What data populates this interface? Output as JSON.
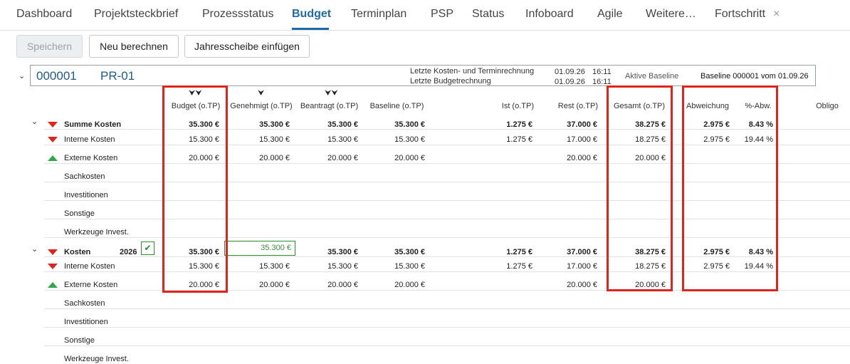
{
  "tabs": [
    {
      "label": "Dashboard",
      "active": false
    },
    {
      "label": "Projektsteckbrief",
      "active": false
    },
    {
      "label": "Prozessstatus",
      "active": false
    },
    {
      "label": "Budget",
      "active": true
    },
    {
      "label": "Terminplan",
      "active": false
    },
    {
      "label": "PSP",
      "active": false
    },
    {
      "label": "Status",
      "active": false
    },
    {
      "label": "Infoboard",
      "active": false
    },
    {
      "label": "Agile",
      "active": false
    },
    {
      "label": "Weitere…",
      "active": false
    },
    {
      "label": "Fortschritt",
      "active": false
    }
  ],
  "tab_close_glyph": "×",
  "toolbar": {
    "save_label": "Speichern",
    "recalc_label": "Neu berechnen",
    "insert_year_label": "Jahresscheibe einfügen"
  },
  "project": {
    "id": "000001",
    "name": "PR-01",
    "last_cost_label": "Letzte Kosten- und Terminrechnung",
    "last_budget_label": "Letzte Budgetrechnung",
    "last_cost_date": "01.09.26",
    "last_cost_time": "16:11",
    "last_budget_date": "01.09.26",
    "last_budget_time": "16:11",
    "active_baseline_label": "Aktive Baseline",
    "baseline_value": "Baseline 000001 vom 01.09.26"
  },
  "columns": {
    "budget": "Budget (o.TP)",
    "genehmigt": "Genehmigt (o.TP)",
    "beantragt": "Beantragt (o.TP)",
    "baseline": "Baseline (o.TP)",
    "ist": "Ist (o.TP)",
    "rest": "Rest (o.TP)",
    "gesamt": "Gesamt (o.TP)",
    "abweichung": "Abweichung",
    "pct_abw": "%-Abw.",
    "obligo": "Obligo"
  },
  "column_icons": {
    "budget": "⮟⮟",
    "genehmigt": "⮟",
    "beantragt": "⮟⮟"
  },
  "rows": [
    {
      "label": "Summe Kosten",
      "bold": true,
      "year": "",
      "budget": "35.300 €",
      "genehmigt": "35.300 €",
      "beantragt": "35.300 €",
      "baseline": "35.300 €",
      "ist": "1.275 €",
      "rest": "37.000 €",
      "gesamt": "38.275 €",
      "abw": "2.975 €",
      "pct": "8.43 %"
    },
    {
      "label": "Interne Kosten",
      "bold": false,
      "year": "",
      "budget": "15.300 €",
      "genehmigt": "15.300 €",
      "beantragt": "15.300 €",
      "baseline": "15.300 €",
      "ist": "1.275 €",
      "rest": "17.000 €",
      "gesamt": "18.275 €",
      "abw": "2.975 €",
      "pct": "19.44 %"
    },
    {
      "label": "Externe Kosten",
      "bold": false,
      "year": "",
      "budget": "20.000 €",
      "genehmigt": "20.000 €",
      "beantragt": "20.000 €",
      "baseline": "20.000 €",
      "ist": "",
      "rest": "20.000 €",
      "gesamt": "20.000 €",
      "abw": "",
      "pct": ""
    },
    {
      "label": "Sachkosten",
      "bold": false,
      "year": "",
      "budget": "",
      "genehmigt": "",
      "beantragt": "",
      "baseline": "",
      "ist": "",
      "rest": "",
      "gesamt": "",
      "abw": "",
      "pct": ""
    },
    {
      "label": "Investitionen",
      "bold": false,
      "year": "",
      "budget": "",
      "genehmigt": "",
      "beantragt": "",
      "baseline": "",
      "ist": "",
      "rest": "",
      "gesamt": "",
      "abw": "",
      "pct": ""
    },
    {
      "label": "Sonstige",
      "bold": false,
      "year": "",
      "budget": "",
      "genehmigt": "",
      "beantragt": "",
      "baseline": "",
      "ist": "",
      "rest": "",
      "gesamt": "",
      "abw": "",
      "pct": ""
    },
    {
      "label": "Werkzeuge Invest.",
      "bold": false,
      "year": "",
      "budget": "",
      "genehmigt": "",
      "beantragt": "",
      "baseline": "",
      "ist": "",
      "rest": "",
      "gesamt": "",
      "abw": "",
      "pct": ""
    },
    {
      "label": "Kosten",
      "bold": true,
      "year": "2026",
      "budget": "35.300 €",
      "genehmigt": "35.300 €",
      "beantragt": "35.300 €",
      "baseline": "35.300 €",
      "ist": "1.275 €",
      "rest": "37.000 €",
      "gesamt": "38.275 €",
      "abw": "2.975 €",
      "pct": "8.43 %"
    },
    {
      "label": "Interne Kosten",
      "bold": false,
      "year": "",
      "budget": "15.300 €",
      "genehmigt": "15.300 €",
      "beantragt": "15.300 €",
      "baseline": "15.300 €",
      "ist": "1.275 €",
      "rest": "17.000 €",
      "gesamt": "18.275 €",
      "abw": "2.975 €",
      "pct": "19.44 %"
    },
    {
      "label": "Externe Kosten",
      "bold": false,
      "year": "",
      "budget": "20.000 €",
      "genehmigt": "20.000 €",
      "beantragt": "20.000 €",
      "baseline": "20.000 €",
      "ist": "",
      "rest": "20.000 €",
      "gesamt": "20.000 €",
      "abw": "",
      "pct": ""
    },
    {
      "label": "Sachkosten",
      "bold": false,
      "year": "",
      "budget": "",
      "genehmigt": "",
      "beantragt": "",
      "baseline": "",
      "ist": "",
      "rest": "",
      "gesamt": "",
      "abw": "",
      "pct": ""
    },
    {
      "label": "Investitionen",
      "bold": false,
      "year": "",
      "budget": "",
      "genehmigt": "",
      "beantragt": "",
      "baseline": "",
      "ist": "",
      "rest": "",
      "gesamt": "",
      "abw": "",
      "pct": ""
    },
    {
      "label": "Sonstige",
      "bold": false,
      "year": "",
      "budget": "",
      "genehmigt": "",
      "beantragt": "",
      "baseline": "",
      "ist": "",
      "rest": "",
      "gesamt": "",
      "abw": "",
      "pct": ""
    },
    {
      "label": "Werkzeuge Invest.",
      "bold": false,
      "year": "",
      "budget": "",
      "genehmigt": "",
      "beantragt": "",
      "baseline": "",
      "ist": "",
      "rest": "",
      "gesamt": "",
      "abw": "",
      "pct": ""
    }
  ],
  "colors": {
    "accent": "#1e6aa6",
    "highlight": "#e0241b",
    "trend_down": "#e0241b",
    "trend_up": "#2ea84a",
    "edit_green": "#2e8b2e"
  }
}
